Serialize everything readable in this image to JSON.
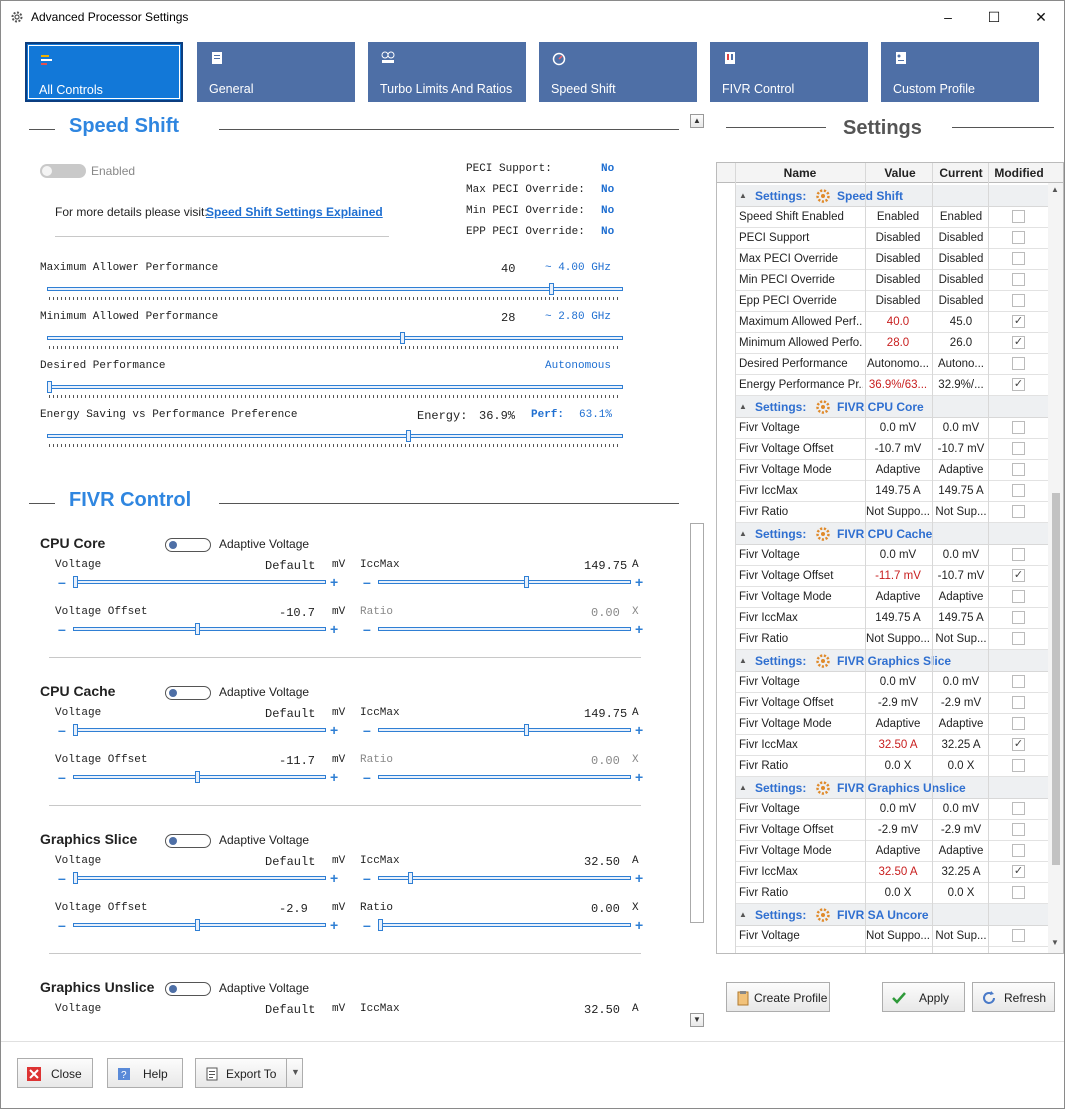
{
  "window": {
    "title": "Advanced Processor Settings",
    "minimize": "–",
    "maximize": "☐",
    "close": "✕"
  },
  "tabs": [
    {
      "label": "All Controls"
    },
    {
      "label": "General"
    },
    {
      "label": "Turbo Limits And Ratios"
    },
    {
      "label": "Speed Shift"
    },
    {
      "label": "FIVR Control"
    },
    {
      "label": "Custom Profile"
    }
  ],
  "speed_shift": {
    "title": "Speed Shift",
    "toggle_label": "Enabled",
    "details_text": "For more details please visit:",
    "details_link": "Speed Shift Settings Explained",
    "peci": [
      {
        "label": "PECI Support:",
        "value": "No"
      },
      {
        "label": "Max PECI Override:",
        "value": "No"
      },
      {
        "label": "Min PECI Override:",
        "value": "No"
      },
      {
        "label": "EPP PECI Override:",
        "value": "No"
      }
    ],
    "max_perf": {
      "label": "Maximum Allower Performance",
      "value": "40",
      "ghz": "~ 4.00 GHz",
      "level": 0.88
    },
    "min_perf": {
      "label": "Minimum Allowed Performance",
      "value": "28",
      "ghz": "~ 2.80 GHz",
      "level": 0.62
    },
    "desired": {
      "label": "Desired Performance",
      "value": "Autonomous",
      "level": 0.0
    },
    "energy": {
      "label": "Energy Saving vs Performance Preference",
      "energy_label": "Energy:",
      "energy_value": "36.9%",
      "perf_label": "Perf:",
      "perf_value": "63.1%",
      "level": 0.63
    }
  },
  "fivr": {
    "title": "FIVR Control",
    "adaptive_label": "Adaptive Voltage",
    "voltage_label": "Voltage",
    "offset_label": "Voltage Offset",
    "iccmax_label": "IccMax",
    "ratio_label": "Ratio",
    "unit_mv": "mV",
    "unit_a": "A",
    "unit_x": "X",
    "minus": "–",
    "plus": "+",
    "sections": [
      {
        "name": "CPU Core",
        "voltage": "Default",
        "offset": "-10.7",
        "iccmax": "149.75",
        "ratio": "0.00"
      },
      {
        "name": "CPU Cache",
        "voltage": "Default",
        "offset": "-11.7",
        "iccmax": "149.75",
        "ratio": "0.00"
      },
      {
        "name": "Graphics Slice",
        "voltage": "Default",
        "offset": "-2.9",
        "iccmax": "32.50",
        "ratio": "0.00"
      },
      {
        "name": "Graphics Unslice",
        "voltage": "Default",
        "iccmax": "32.50"
      }
    ]
  },
  "settings": {
    "title": "Settings",
    "columns": [
      "Name",
      "Value",
      "Current",
      "Modified"
    ],
    "sections": [
      {
        "header": "Settings:",
        "name": "Speed Shift",
        "rows": [
          {
            "name": "Speed Shift Enabled",
            "value": "Enabled",
            "current": "Enabled",
            "modified": false,
            "red": false
          },
          {
            "name": "PECI Support",
            "value": "Disabled",
            "current": "Disabled",
            "modified": false,
            "red": false
          },
          {
            "name": "Max PECI Override",
            "value": "Disabled",
            "current": "Disabled",
            "modified": false,
            "red": false
          },
          {
            "name": "Min PECI Override",
            "value": "Disabled",
            "current": "Disabled",
            "modified": false,
            "red": false
          },
          {
            "name": "Epp PECI Override",
            "value": "Disabled",
            "current": "Disabled",
            "modified": false,
            "red": false
          },
          {
            "name": "Maximum Allowed Perf...",
            "value": "40.0",
            "current": "45.0",
            "modified": true,
            "red": true
          },
          {
            "name": "Minimum Allowed Perfo...",
            "value": "28.0",
            "current": "26.0",
            "modified": true,
            "red": true
          },
          {
            "name": "Desired Performance",
            "value": "Autonomo...",
            "current": "Autono...",
            "modified": false,
            "red": false
          },
          {
            "name": "Energy Performance Pr...",
            "value": "36.9%/63...",
            "current": "32.9%/...",
            "modified": true,
            "red": true
          }
        ]
      },
      {
        "header": "Settings:",
        "name": "FIVR CPU Core",
        "rows": [
          {
            "name": "Fivr Voltage",
            "value": "0.0 mV",
            "current": "0.0 mV",
            "modified": false,
            "red": false
          },
          {
            "name": "Fivr Voltage Offset",
            "value": "-10.7 mV",
            "current": "-10.7 mV",
            "modified": false,
            "red": false
          },
          {
            "name": "Fivr Voltage Mode",
            "value": "Adaptive",
            "current": "Adaptive",
            "modified": false,
            "red": false
          },
          {
            "name": "Fivr IccMax",
            "value": "149.75 A",
            "current": "149.75 A",
            "modified": false,
            "red": false
          },
          {
            "name": "Fivr Ratio",
            "value": "Not Suppo...",
            "current": "Not Sup...",
            "modified": false,
            "red": false
          }
        ]
      },
      {
        "header": "Settings:",
        "name": "FIVR CPU Cache",
        "rows": [
          {
            "name": "Fivr Voltage",
            "value": "0.0 mV",
            "current": "0.0 mV",
            "modified": false,
            "red": false
          },
          {
            "name": "Fivr Voltage Offset",
            "value": "-11.7 mV",
            "current": "-10.7 mV",
            "modified": true,
            "red": true
          },
          {
            "name": "Fivr Voltage Mode",
            "value": "Adaptive",
            "current": "Adaptive",
            "modified": false,
            "red": false
          },
          {
            "name": "Fivr IccMax",
            "value": "149.75 A",
            "current": "149.75 A",
            "modified": false,
            "red": false
          },
          {
            "name": "Fivr Ratio",
            "value": "Not Suppo...",
            "current": "Not Sup...",
            "modified": false,
            "red": false
          }
        ]
      },
      {
        "header": "Settings:",
        "name": "FIVR Graphics Slice",
        "rows": [
          {
            "name": "Fivr Voltage",
            "value": "0.0 mV",
            "current": "0.0 mV",
            "modified": false,
            "red": false
          },
          {
            "name": "Fivr Voltage Offset",
            "value": "-2.9 mV",
            "current": "-2.9 mV",
            "modified": false,
            "red": false
          },
          {
            "name": "Fivr Voltage Mode",
            "value": "Adaptive",
            "current": "Adaptive",
            "modified": false,
            "red": false
          },
          {
            "name": "Fivr IccMax",
            "value": "32.50 A",
            "current": "32.25 A",
            "modified": true,
            "red": true
          },
          {
            "name": "Fivr Ratio",
            "value": "0.0 X",
            "current": "0.0 X",
            "modified": false,
            "red": false
          }
        ]
      },
      {
        "header": "Settings:",
        "name": "FIVR Graphics Unslice",
        "rows": [
          {
            "name": "Fivr Voltage",
            "value": "0.0 mV",
            "current": "0.0 mV",
            "modified": false,
            "red": false
          },
          {
            "name": "Fivr Voltage Offset",
            "value": "-2.9 mV",
            "current": "-2.9 mV",
            "modified": false,
            "red": false
          },
          {
            "name": "Fivr Voltage Mode",
            "value": "Adaptive",
            "current": "Adaptive",
            "modified": false,
            "red": false
          },
          {
            "name": "Fivr IccMax",
            "value": "32.50 A",
            "current": "32.25 A",
            "modified": true,
            "red": true
          },
          {
            "name": "Fivr Ratio",
            "value": "0.0 X",
            "current": "0.0 X",
            "modified": false,
            "red": false
          }
        ]
      },
      {
        "header": "Settings:",
        "name": "FIVR SA Uncore",
        "rows": [
          {
            "name": "Fivr Voltage",
            "value": "Not Suppo...",
            "current": "Not Sup...",
            "modified": false,
            "red": false
          }
        ]
      }
    ],
    "check_mark": "✓"
  },
  "buttons": {
    "create_profile": "Create Profile",
    "apply": "Apply",
    "refresh": "Refresh",
    "close": "Close",
    "help": "Help",
    "export": "Export To"
  },
  "scroll": {
    "up": "▲",
    "down": "▼"
  }
}
